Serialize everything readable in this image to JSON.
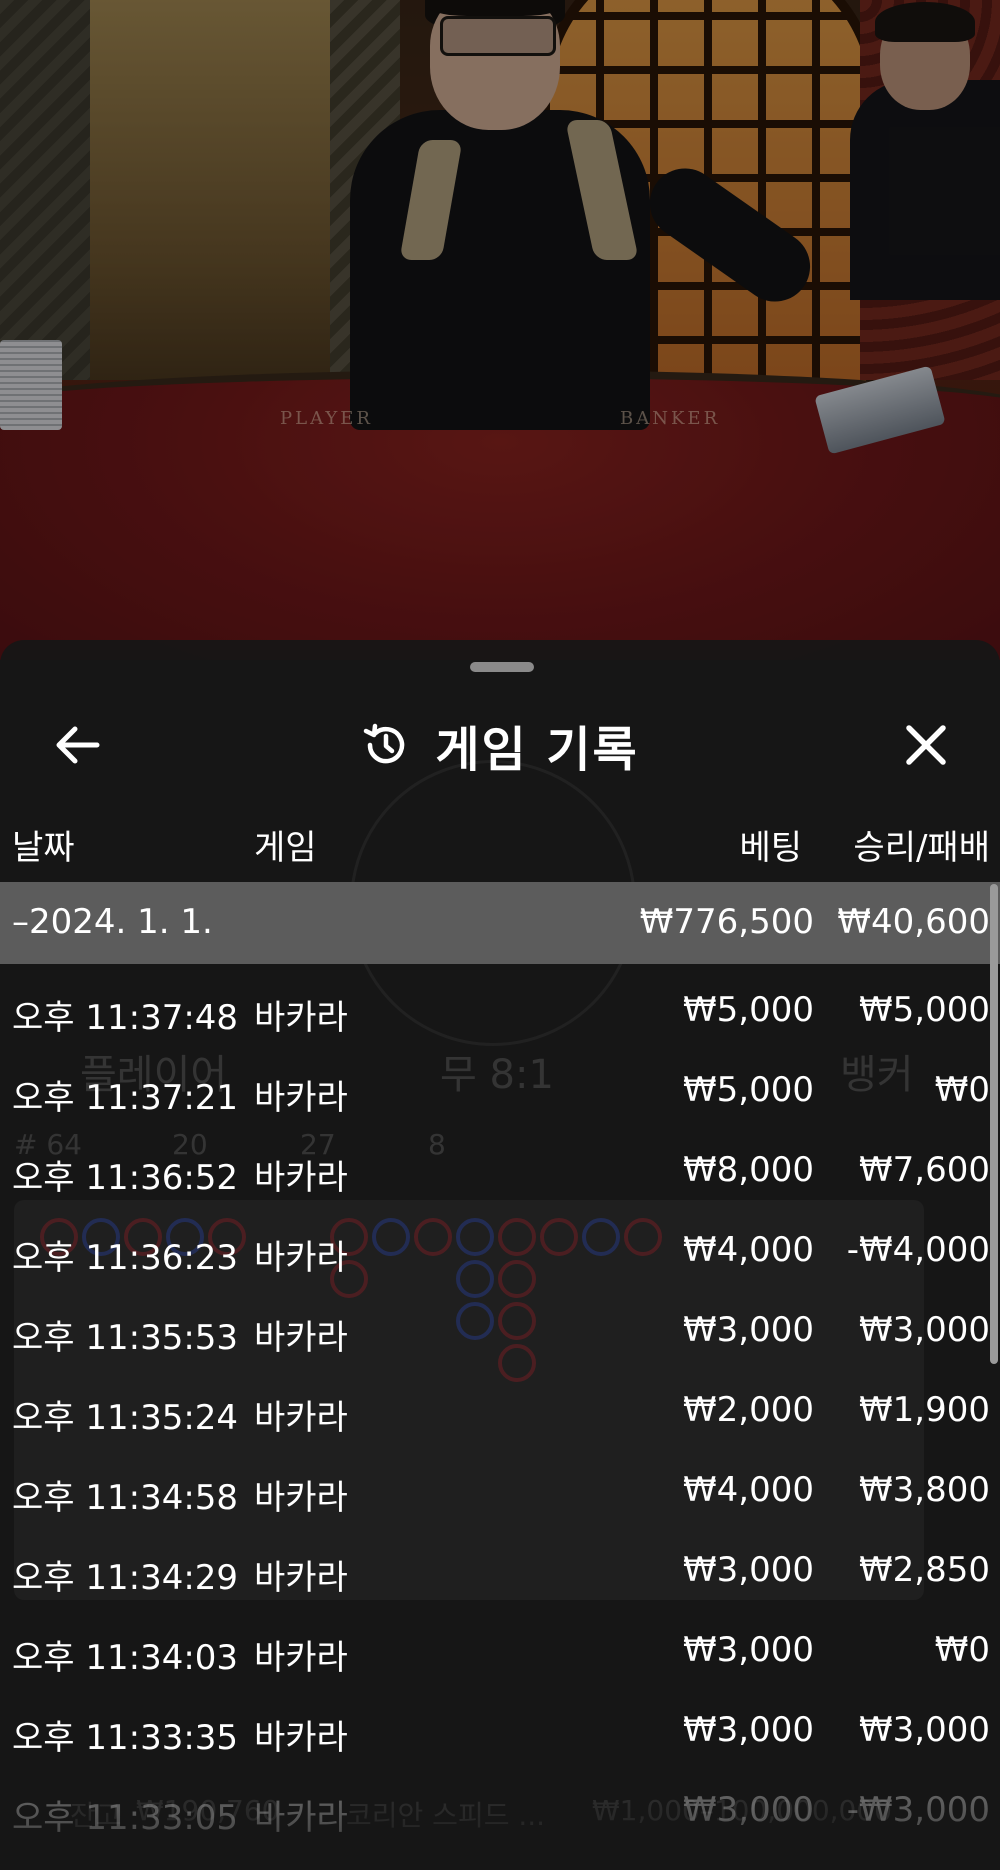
{
  "video": {
    "felt_player_label": "PLAYER",
    "felt_banker_label": "BANKER"
  },
  "sheet": {
    "title": "게임 기록",
    "back_icon": "arrow-left-icon",
    "history_icon": "history-clock-icon",
    "close_icon": "close-x-icon"
  },
  "columns": {
    "date": "날짜",
    "game": "게임",
    "bet": "베팅",
    "win_loss": "승리/패배"
  },
  "summary": {
    "date": "–2024. 1. 1.",
    "bet": "₩776,500",
    "win_loss": "₩40,600"
  },
  "rows": [
    {
      "time": "오후 11:37:48",
      "game": "바카라",
      "bet": "₩5,000",
      "win_loss": "₩5,000"
    },
    {
      "time": "오후 11:37:21",
      "game": "바카라",
      "bet": "₩5,000",
      "win_loss": "₩0"
    },
    {
      "time": "오후 11:36:52",
      "game": "바카라",
      "bet": "₩8,000",
      "win_loss": "₩7,600"
    },
    {
      "time": "오후 11:36:23",
      "game": "바카라",
      "bet": "₩4,000",
      "win_loss": "-₩4,000"
    },
    {
      "time": "오후 11:35:53",
      "game": "바카라",
      "bet": "₩3,000",
      "win_loss": "₩3,000"
    },
    {
      "time": "오후 11:35:24",
      "game": "바카라",
      "bet": "₩2,000",
      "win_loss": "₩1,900"
    },
    {
      "time": "오후 11:34:58",
      "game": "바카라",
      "bet": "₩4,000",
      "win_loss": "₩3,800"
    },
    {
      "time": "오후 11:34:29",
      "game": "바카라",
      "bet": "₩3,000",
      "win_loss": "₩2,850"
    },
    {
      "time": "오후 11:34:03",
      "game": "바카라",
      "bet": "₩3,000",
      "win_loss": "₩0"
    },
    {
      "time": "오후 11:33:35",
      "game": "바카라",
      "bet": "₩3,000",
      "win_loss": "₩3,000"
    },
    {
      "time": "오후 11:33:05",
      "game": "바카라",
      "bet": "₩3,000",
      "win_loss": "-₩3,000"
    }
  ],
  "background_ui": {
    "player_label": "플레이어",
    "tie_label": "무 8:1",
    "banker_label": "뱅커",
    "round_prefix": "# 64",
    "player_count": "20",
    "banker_count": "27",
    "tie_count": "8",
    "balance_label": "잔고",
    "balance_value": "₩190,760",
    "table_name": "코리안 스피드 ...",
    "limits": "₩1,000–100,000,000"
  },
  "colors": {
    "sheet_bg": "#161616",
    "summary_bg": "#5c5c5c",
    "text": "#ffffff"
  }
}
